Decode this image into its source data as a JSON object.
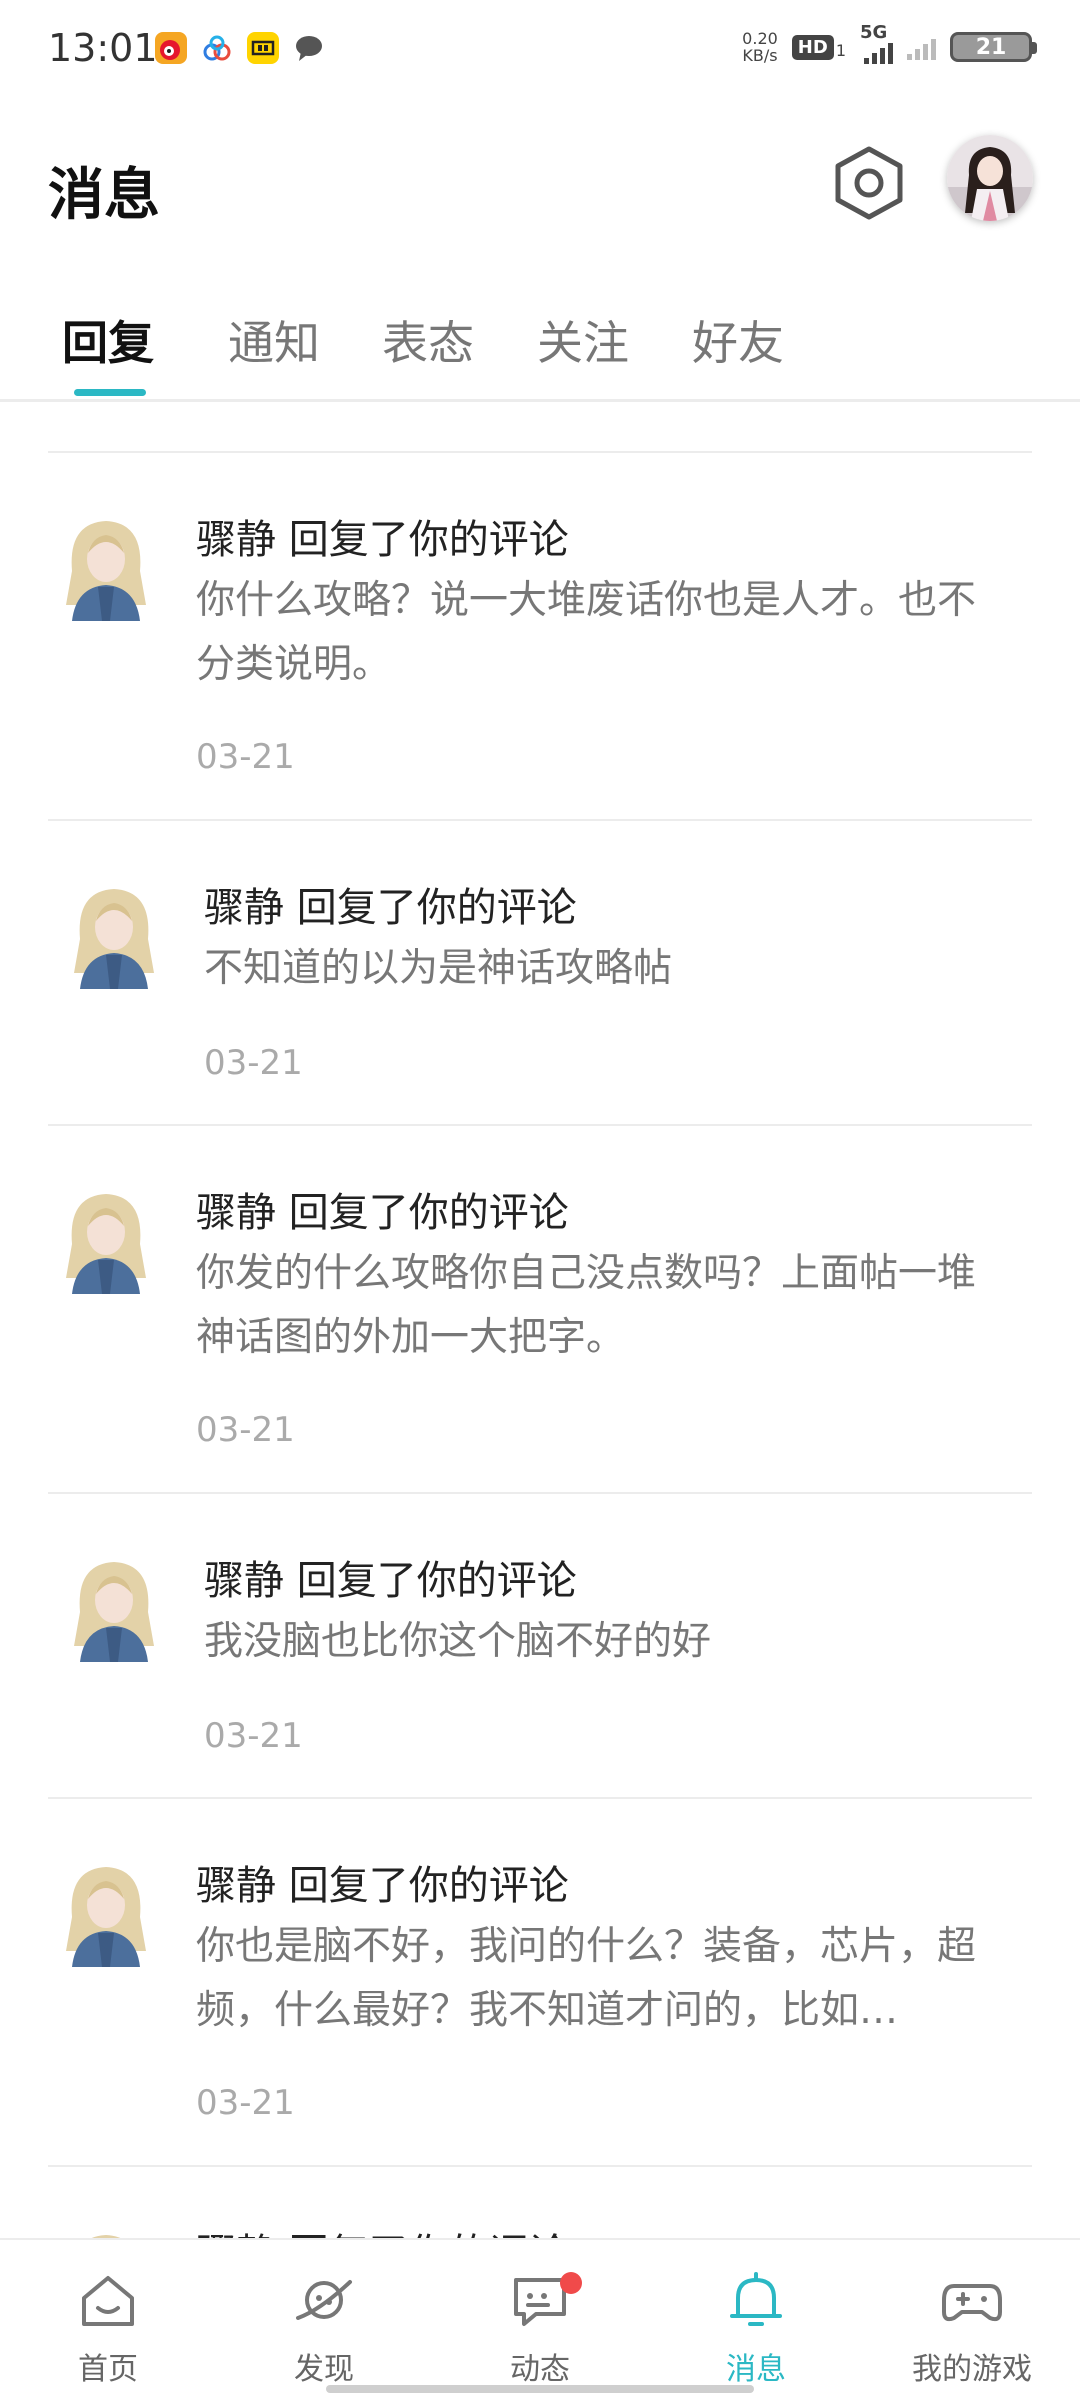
{
  "status_bar": {
    "time": "13:01",
    "net_speed_value": "0.20",
    "net_speed_unit": "KB/s",
    "hd_label": "HD",
    "hd_sub": "1",
    "network_type": "5G",
    "battery_level": "21",
    "app_icons": [
      "weibo-icon",
      "baidu-cloud-icon",
      "app-yellow-icon",
      "chat-bubble-icon"
    ]
  },
  "header": {
    "title": "消息"
  },
  "tabs": [
    {
      "label": "回复",
      "active": true
    },
    {
      "label": "通知",
      "active": false
    },
    {
      "label": "表态",
      "active": false
    },
    {
      "label": "关注",
      "active": false
    },
    {
      "label": "好友",
      "active": false
    }
  ],
  "messages": [
    {
      "title": "骤静 回复了你的评论",
      "body": "你什么攻略？说一大堆废话你也是人才。也不分类说明。",
      "date": "03-21"
    },
    {
      "title": "骤静 回复了你的评论",
      "body": "不知道的以为是神话攻略帖",
      "date": "03-21"
    },
    {
      "title": "骤静 回复了你的评论",
      "body": "你发的什么攻略你自己没点数吗？上面帖一堆神话图的外加一大把字。",
      "date": "03-21"
    },
    {
      "title": "骤静 回复了你的评论",
      "body": "我没脑也比你这个脑不好的好",
      "date": "03-21"
    },
    {
      "title": "骤静 回复了你的评论",
      "body": "你也是脑不好，我问的什么？装备，芯片，超频，什么最好？我不知道才问的，比如…",
      "date": "03-21"
    },
    {
      "title": "骤静 回复了你的评论",
      "body": "",
      "date": ""
    }
  ],
  "bottom_nav": [
    {
      "label": "首页",
      "icon": "home-icon",
      "active": false
    },
    {
      "label": "发现",
      "icon": "planet-icon",
      "active": false
    },
    {
      "label": "动态",
      "icon": "feed-icon",
      "active": false,
      "badge": true
    },
    {
      "label": "消息",
      "icon": "bell-icon",
      "active": true
    },
    {
      "label": "我的游戏",
      "icon": "gamepad-icon",
      "active": false
    }
  ],
  "colors": {
    "accent": "#2bb8c4",
    "badge": "#f04a4a",
    "title_text": "#222222",
    "body_text": "#777777",
    "date_text": "#aaaaaa"
  }
}
